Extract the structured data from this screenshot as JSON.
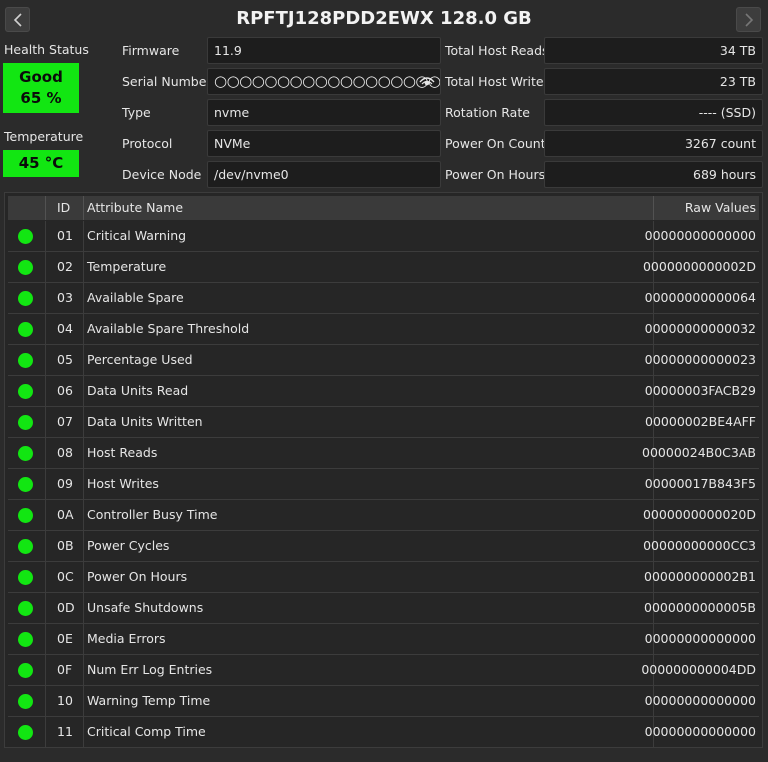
{
  "title": "RPFTJ128PDD2EWX 128.0 GB",
  "status": {
    "health_label": "Health Status",
    "health_value": "Good",
    "health_percent": "65 %",
    "temperature_label": "Temperature",
    "temperature_value": "45 °C",
    "good_color": "#12e612"
  },
  "info_left": [
    {
      "label": "Firmware",
      "value": "11.9"
    },
    {
      "label": "Serial Number",
      "value": "○○○○○○○○○○○○○○○○○○○○○"
    },
    {
      "label": "Type",
      "value": "nvme"
    },
    {
      "label": "Protocol",
      "value": "NVMe"
    },
    {
      "label": "Device Node",
      "value": "/dev/nvme0"
    }
  ],
  "info_right": [
    {
      "label": "Total Host Reads",
      "value": "34 TB"
    },
    {
      "label": "Total Host Writes",
      "value": "23 TB"
    },
    {
      "label": "Rotation Rate",
      "value": "---- (SSD)"
    },
    {
      "label": "Power On Count",
      "value": "3267 count"
    },
    {
      "label": "Power On Hours",
      "value": "689 hours"
    }
  ],
  "icons": {
    "prev": "chevron-left-icon",
    "next": "chevron-right-icon",
    "serial_toggle": "eye-icon",
    "status_dot": "status-dot-icon"
  },
  "table": {
    "headers": {
      "id": "ID",
      "name": "Attribute Name",
      "raw": "Raw Values"
    },
    "rows": [
      {
        "id": "01",
        "name": "Critical Warning",
        "raw": "00000000000000"
      },
      {
        "id": "02",
        "name": "Temperature",
        "raw": "0000000000002D"
      },
      {
        "id": "03",
        "name": "Available Spare",
        "raw": "00000000000064"
      },
      {
        "id": "04",
        "name": "Available Spare Threshold",
        "raw": "00000000000032"
      },
      {
        "id": "05",
        "name": "Percentage Used",
        "raw": "00000000000023"
      },
      {
        "id": "06",
        "name": "Data Units Read",
        "raw": "00000003FACB29"
      },
      {
        "id": "07",
        "name": "Data Units Written",
        "raw": "00000002BE4AFF"
      },
      {
        "id": "08",
        "name": "Host Reads",
        "raw": "00000024B0C3AB"
      },
      {
        "id": "09",
        "name": "Host Writes",
        "raw": "00000017B843F5"
      },
      {
        "id": "0A",
        "name": "Controller Busy Time",
        "raw": "0000000000020D"
      },
      {
        "id": "0B",
        "name": "Power Cycles",
        "raw": "00000000000CC3"
      },
      {
        "id": "0C",
        "name": "Power On Hours",
        "raw": "000000000002B1"
      },
      {
        "id": "0D",
        "name": "Unsafe Shutdowns",
        "raw": "0000000000005B"
      },
      {
        "id": "0E",
        "name": "Media Errors",
        "raw": "00000000000000"
      },
      {
        "id": "0F",
        "name": "Num Err Log Entries",
        "raw": "000000000004DD"
      },
      {
        "id": "10",
        "name": "Warning Temp Time",
        "raw": "00000000000000"
      },
      {
        "id": "11",
        "name": "Critical Comp Time",
        "raw": "00000000000000"
      }
    ]
  }
}
